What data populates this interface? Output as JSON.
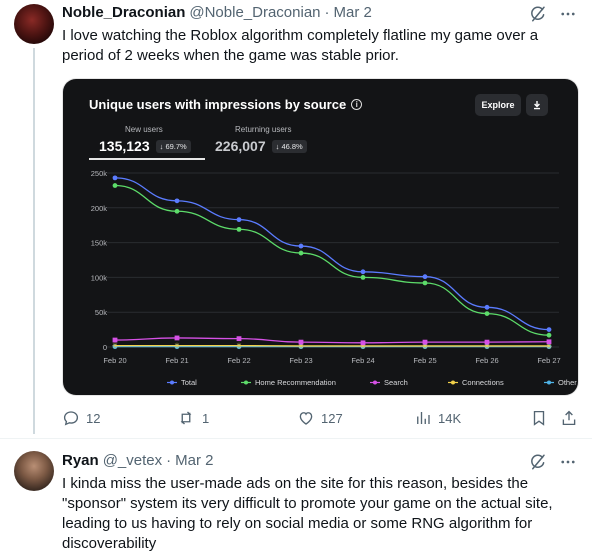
{
  "tweet1": {
    "display_name": "Noble_Draconian",
    "handle": "@Noble_Draconian",
    "separator": "·",
    "date": "Mar 2",
    "text": "I love watching the Roblox algorithm completely flatline my game over a period of 2 weeks when the game was stable prior.",
    "actions": {
      "replies": "12",
      "reposts": "1",
      "likes": "127",
      "views": "14K"
    }
  },
  "tweet2": {
    "display_name": "Ryan",
    "handle": "@_vetex",
    "separator": "·",
    "date": "Mar 2",
    "text": "I kinda miss the user-made ads on the site for this reason, besides the \"sponsor\" system its very difficult to promote your game on the actual site, leading to us having to rely on social media or some RNG algorithm for discoverability"
  },
  "chart_card": {
    "title": "Unique users with impressions by source",
    "explore_label": "Explore",
    "metrics": [
      {
        "label": "New users",
        "value": "135,123",
        "change": "↓ 69.7%"
      },
      {
        "label": "Returning users",
        "value": "226,007",
        "change": "↓ 46.8%"
      }
    ]
  },
  "chart_data": {
    "type": "line",
    "title": "Unique users with impressions by source",
    "x": [
      "Feb 20",
      "Feb 21",
      "Feb 22",
      "Feb 23",
      "Feb 24",
      "Feb 25",
      "Feb 26",
      "Feb 27"
    ],
    "y_ticks": [
      "250k",
      "200k",
      "150k",
      "100k",
      "50k",
      "0"
    ],
    "ylim": [
      0,
      250000
    ],
    "grid": true,
    "legend_position": "bottom",
    "series": [
      {
        "name": "Total",
        "color": "#5b7cff",
        "values": [
          243000,
          210000,
          183000,
          145000,
          108000,
          101000,
          57000,
          25000
        ]
      },
      {
        "name": "Home Recommendation",
        "color": "#5ddc6a",
        "values": [
          232000,
          195000,
          169000,
          135000,
          100000,
          92000,
          48000,
          17000
        ]
      },
      {
        "name": "Search",
        "color": "#d651e6",
        "values": [
          10000,
          13000,
          12000,
          7000,
          6000,
          7000,
          7000,
          7500
        ]
      },
      {
        "name": "Connections",
        "color": "#f1d04a",
        "values": [
          2000,
          2000,
          2000,
          1500,
          1500,
          1500,
          1500,
          1500
        ]
      },
      {
        "name": "Other",
        "color": "#4fb3e6",
        "values": [
          500,
          500,
          500,
          500,
          500,
          500,
          500,
          500
        ]
      }
    ]
  }
}
